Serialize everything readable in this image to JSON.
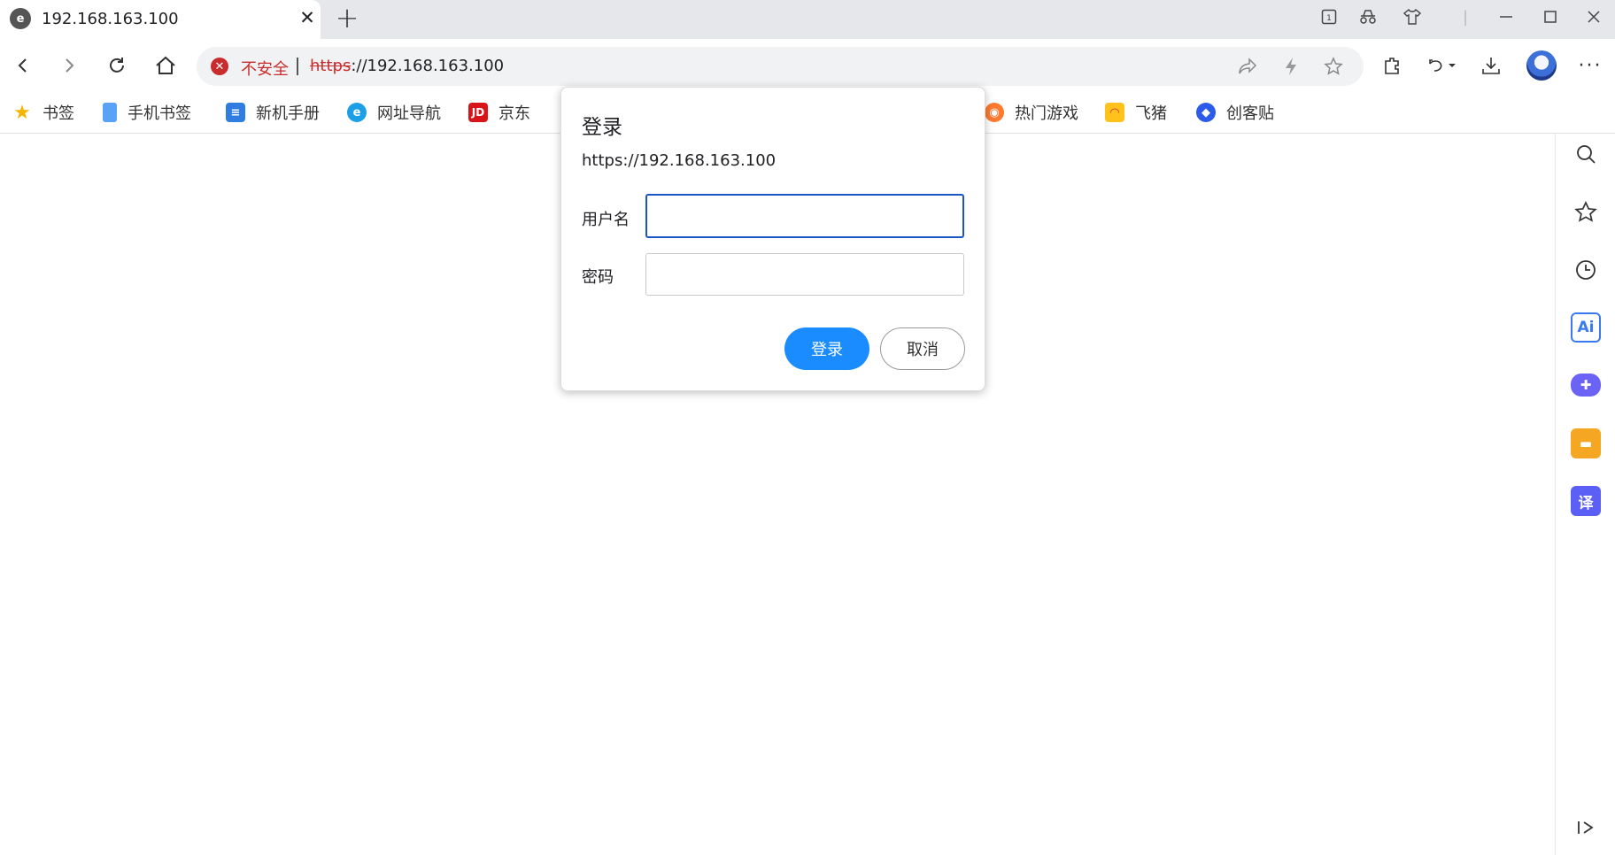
{
  "tab": {
    "title": "192.168.163.100",
    "close": "✕"
  },
  "newtab": "+",
  "address": {
    "security_label": "不安全",
    "url_scheme": "https",
    "url_rest": "://192.168.163.100"
  },
  "bookmarks": [
    {
      "label": "书签",
      "icon": "star-icon"
    },
    {
      "label": "手机书签",
      "icon": "phone-icon"
    },
    {
      "label": "新机手册",
      "icon": "book-icon"
    },
    {
      "label": "网址导航",
      "icon": "browser-e-icon"
    },
    {
      "label": "京东",
      "icon": "jd-icon",
      "glyph": "JD"
    },
    {
      "label": "热门游戏",
      "icon": "game-icon"
    },
    {
      "label": "飞猪",
      "icon": "fliggy-icon"
    },
    {
      "label": "创客贴",
      "icon": "chuangkit-icon"
    }
  ],
  "dialog": {
    "title": "登录",
    "url": "https://192.168.163.100",
    "username_label": "用户名",
    "password_label": "密码",
    "username_value": "",
    "password_value": "",
    "login_button": "登录",
    "cancel_button": "取消"
  },
  "sidebar": {
    "ai_label": "Ai",
    "translate_label": "译"
  },
  "colors": {
    "accent": "#1a8cff",
    "focus": "#1a56c4",
    "insecure": "#c92c2c"
  }
}
